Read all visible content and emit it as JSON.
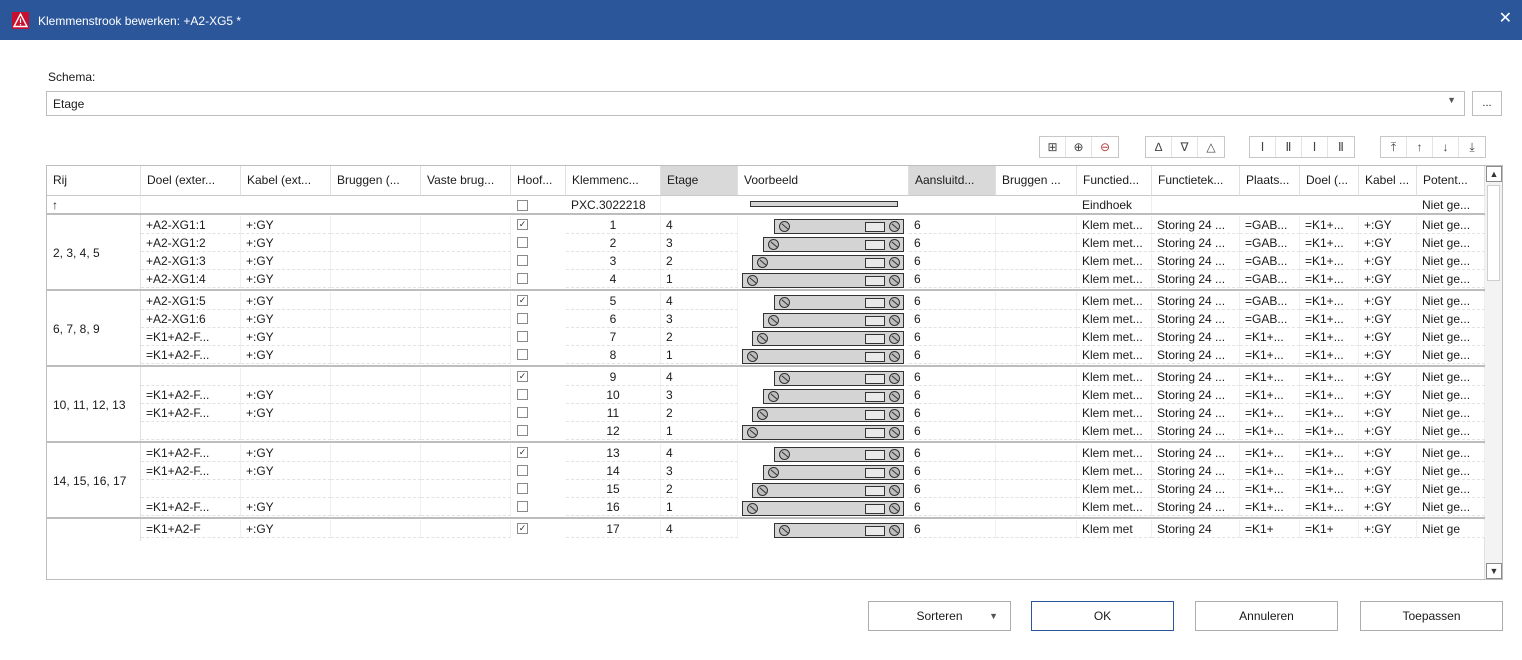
{
  "window": {
    "title": "Klemmenstrook bewerken: +A2-XG5 *",
    "close_glyph": "✕",
    "warning_icon": "warning-triangle-icon",
    "titlebar_color": "#2b579a",
    "accent_color": "#c8102e"
  },
  "schema": {
    "label": "Schema:",
    "value": "Etage",
    "more_button": "..."
  },
  "toolbar": {
    "icons": [
      "insert-terminal-icon",
      "insert-terminal-after-icon",
      "delete-terminal-icon",
      "add-accessory-icon",
      "edit-accessory-icon",
      "remove-accessory-icon",
      "insert-space-icon",
      "delete-space-icon",
      "insert-space-after-icon",
      "delete-space-after-icon",
      "move-to-top-icon",
      "move-up-icon",
      "move-down-icon",
      "move-to-bottom-icon"
    ]
  },
  "grid": {
    "columns": [
      "Rij",
      "Doel (exter...",
      "Kabel (ext...",
      "Bruggen (...",
      "Vaste brug...",
      "Hoof...",
      "Klemmenc...",
      "Etage",
      "Voorbeeld",
      "Aansluitd...",
      "Bruggen ...",
      "Functied...",
      "Functietek...",
      "Plaats...",
      "Doel (...",
      "Kabel ...",
      "Potent..."
    ],
    "header_row": {
      "symbol": "↑",
      "klemmen": "PXC.3022218",
      "functie": "Eindhoek",
      "potentiaal": "Niet ge..."
    },
    "groups": [
      {
        "rij": "2, 3, 4, 5",
        "rows": [
          {
            "doel": "+A2-XG1:1",
            "kabel": "+:GY",
            "hoofd": true,
            "nr": "1",
            "etage": "4",
            "aansl": "6",
            "functie": "Klem met...",
            "tekst": "Storing 24 ...",
            "plaats": "=GAB...",
            "doel2": "=K1+...",
            "kabel2": "+:GY",
            "pot": "Niet ge..."
          },
          {
            "doel": "+A2-XG1:2",
            "kabel": "+:GY",
            "hoofd": false,
            "nr": "2",
            "etage": "3",
            "aansl": "6",
            "functie": "Klem met...",
            "tekst": "Storing 24 ...",
            "plaats": "=GAB...",
            "doel2": "=K1+...",
            "kabel2": "+:GY",
            "pot": "Niet ge..."
          },
          {
            "doel": "+A2-XG1:3",
            "kabel": "+:GY",
            "hoofd": false,
            "nr": "3",
            "etage": "2",
            "aansl": "6",
            "functie": "Klem met...",
            "tekst": "Storing 24 ...",
            "plaats": "=GAB...",
            "doel2": "=K1+...",
            "kabel2": "+:GY",
            "pot": "Niet ge..."
          },
          {
            "doel": "+A2-XG1:4",
            "kabel": "+:GY",
            "hoofd": false,
            "nr": "4",
            "etage": "1",
            "aansl": "6",
            "functie": "Klem met...",
            "tekst": "Storing 24 ...",
            "plaats": "=GAB...",
            "doel2": "=K1+...",
            "kabel2": "+:GY",
            "pot": "Niet ge..."
          }
        ]
      },
      {
        "rij": "6, 7, 8, 9",
        "rows": [
          {
            "doel": "+A2-XG1:5",
            "kabel": "+:GY",
            "hoofd": true,
            "nr": "5",
            "etage": "4",
            "aansl": "6",
            "functie": "Klem met...",
            "tekst": "Storing 24 ...",
            "plaats": "=GAB...",
            "doel2": "=K1+...",
            "kabel2": "+:GY",
            "pot": "Niet ge..."
          },
          {
            "doel": "+A2-XG1:6",
            "kabel": "+:GY",
            "hoofd": false,
            "nr": "6",
            "etage": "3",
            "aansl": "6",
            "functie": "Klem met...",
            "tekst": "Storing 24 ...",
            "plaats": "=GAB...",
            "doel2": "=K1+...",
            "kabel2": "+:GY",
            "pot": "Niet ge..."
          },
          {
            "doel": "=K1+A2-F...",
            "kabel": "+:GY",
            "hoofd": false,
            "nr": "7",
            "etage": "2",
            "aansl": "6",
            "functie": "Klem met...",
            "tekst": "Storing 24 ...",
            "plaats": "=K1+...",
            "doel2": "=K1+...",
            "kabel2": "+:GY",
            "pot": "Niet ge..."
          },
          {
            "doel": "=K1+A2-F...",
            "kabel": "+:GY",
            "hoofd": false,
            "nr": "8",
            "etage": "1",
            "aansl": "6",
            "functie": "Klem met...",
            "tekst": "Storing 24 ...",
            "plaats": "=K1+...",
            "doel2": "=K1+...",
            "kabel2": "+:GY",
            "pot": "Niet ge..."
          }
        ]
      },
      {
        "rij": "10, 11, 12, 13",
        "rows": [
          {
            "doel": "",
            "kabel": "",
            "hoofd": true,
            "nr": "9",
            "etage": "4",
            "aansl": "6",
            "functie": "Klem met...",
            "tekst": "Storing 24 ...",
            "plaats": "=K1+...",
            "doel2": "=K1+...",
            "kabel2": "+:GY",
            "pot": "Niet ge..."
          },
          {
            "doel": "=K1+A2-F...",
            "kabel": "+:GY",
            "hoofd": false,
            "nr": "10",
            "etage": "3",
            "aansl": "6",
            "functie": "Klem met...",
            "tekst": "Storing 24 ...",
            "plaats": "=K1+...",
            "doel2": "=K1+...",
            "kabel2": "+:GY",
            "pot": "Niet ge..."
          },
          {
            "doel": "=K1+A2-F...",
            "kabel": "+:GY",
            "hoofd": false,
            "nr": "11",
            "etage": "2",
            "aansl": "6",
            "functie": "Klem met...",
            "tekst": "Storing 24 ...",
            "plaats": "=K1+...",
            "doel2": "=K1+...",
            "kabel2": "+:GY",
            "pot": "Niet ge..."
          },
          {
            "doel": "",
            "kabel": "",
            "hoofd": false,
            "nr": "12",
            "etage": "1",
            "aansl": "6",
            "functie": "Klem met...",
            "tekst": "Storing 24 ...",
            "plaats": "=K1+...",
            "doel2": "=K1+...",
            "kabel2": "+:GY",
            "pot": "Niet ge..."
          }
        ]
      },
      {
        "rij": "14, 15, 16, 17",
        "rows": [
          {
            "doel": "=K1+A2-F...",
            "kabel": "+:GY",
            "hoofd": true,
            "nr": "13",
            "etage": "4",
            "aansl": "6",
            "functie": "Klem met...",
            "tekst": "Storing 24 ...",
            "plaats": "=K1+...",
            "doel2": "=K1+...",
            "kabel2": "+:GY",
            "pot": "Niet ge..."
          },
          {
            "doel": "=K1+A2-F...",
            "kabel": "+:GY",
            "hoofd": false,
            "nr": "14",
            "etage": "3",
            "aansl": "6",
            "functie": "Klem met...",
            "tekst": "Storing 24 ...",
            "plaats": "=K1+...",
            "doel2": "=K1+...",
            "kabel2": "+:GY",
            "pot": "Niet ge..."
          },
          {
            "doel": "",
            "kabel": "",
            "hoofd": false,
            "nr": "15",
            "etage": "2",
            "aansl": "6",
            "functie": "Klem met...",
            "tekst": "Storing 24 ...",
            "plaats": "=K1+...",
            "doel2": "=K1+...",
            "kabel2": "+:GY",
            "pot": "Niet ge..."
          },
          {
            "doel": "=K1+A2-F...",
            "kabel": "+:GY",
            "hoofd": false,
            "nr": "16",
            "etage": "1",
            "aansl": "6",
            "functie": "Klem met...",
            "tekst": "Storing 24 ...",
            "plaats": "=K1+...",
            "doel2": "=K1+...",
            "kabel2": "+:GY",
            "pot": "Niet ge..."
          }
        ]
      },
      {
        "rij": "",
        "rows": [
          {
            "doel": "=K1+A2-F",
            "kabel": "+:GY",
            "hoofd": true,
            "nr": "17",
            "etage": "4",
            "aansl": "6",
            "functie": "Klem met",
            "tekst": "Storing 24",
            "plaats": "=K1+",
            "doel2": "=K1+",
            "kabel2": "+:GY",
            "pot": "Niet ge"
          }
        ]
      }
    ]
  },
  "buttons": {
    "sort": "Sorteren",
    "ok": "OK",
    "cancel": "Annuleren",
    "apply": "Toepassen"
  }
}
